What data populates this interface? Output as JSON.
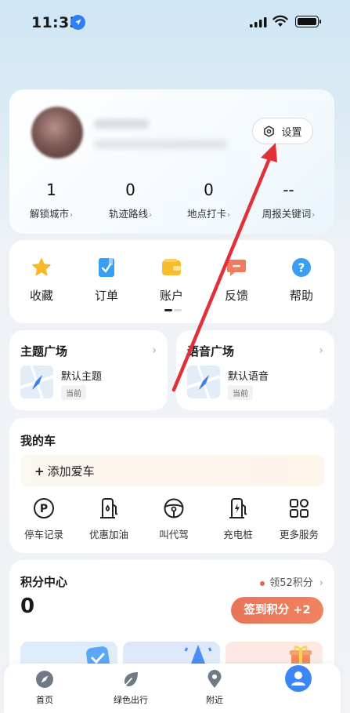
{
  "status_bar": {
    "time": "11:35"
  },
  "profile": {
    "settings_label": "设置",
    "stats": [
      {
        "value": "1",
        "label": "解锁城市"
      },
      {
        "value": "0",
        "label": "轨迹路线"
      },
      {
        "value": "0",
        "label": "地点打卡"
      },
      {
        "value": "--",
        "label": "周报关键词"
      }
    ]
  },
  "quick_menu": {
    "items": [
      {
        "label": "收藏",
        "icon": "star-icon"
      },
      {
        "label": "订单",
        "icon": "order-icon"
      },
      {
        "label": "账户",
        "icon": "wallet-icon"
      },
      {
        "label": "反馈",
        "icon": "feedback-icon"
      },
      {
        "label": "帮助",
        "icon": "help-icon"
      }
    ]
  },
  "theme_square": {
    "title": "主题广场",
    "item_name": "默认主题",
    "tag": "当前"
  },
  "voice_square": {
    "title": "语音广场",
    "item_name": "默认语音",
    "tag": "当前"
  },
  "my_car": {
    "title": "我的车",
    "add_car_label": "添加爱车",
    "services": [
      {
        "label": "停车记录",
        "icon": "parking-icon"
      },
      {
        "label": "优惠加油",
        "icon": "fuel-icon"
      },
      {
        "label": "叫代驾",
        "icon": "steering-wheel-icon"
      },
      {
        "label": "充电桩",
        "icon": "charging-icon"
      },
      {
        "label": "更多服务",
        "icon": "grid-icon"
      }
    ]
  },
  "points_center": {
    "title": "积分中心",
    "claim_label": "领52积分",
    "points_value": "0",
    "sign_button": "签到积分 +2"
  },
  "bottom_nav": {
    "items": [
      {
        "label": "首页",
        "icon": "compass-icon"
      },
      {
        "label": "绿色出行",
        "icon": "leaf-icon"
      },
      {
        "label": "附近",
        "icon": "location-pin-icon"
      },
      {
        "label": "",
        "icon": "user-icon"
      }
    ]
  },
  "colors": {
    "accent_blue": "#2f7ff5",
    "points_button": "#ea785c",
    "annotation_arrow": "#e0303a"
  }
}
